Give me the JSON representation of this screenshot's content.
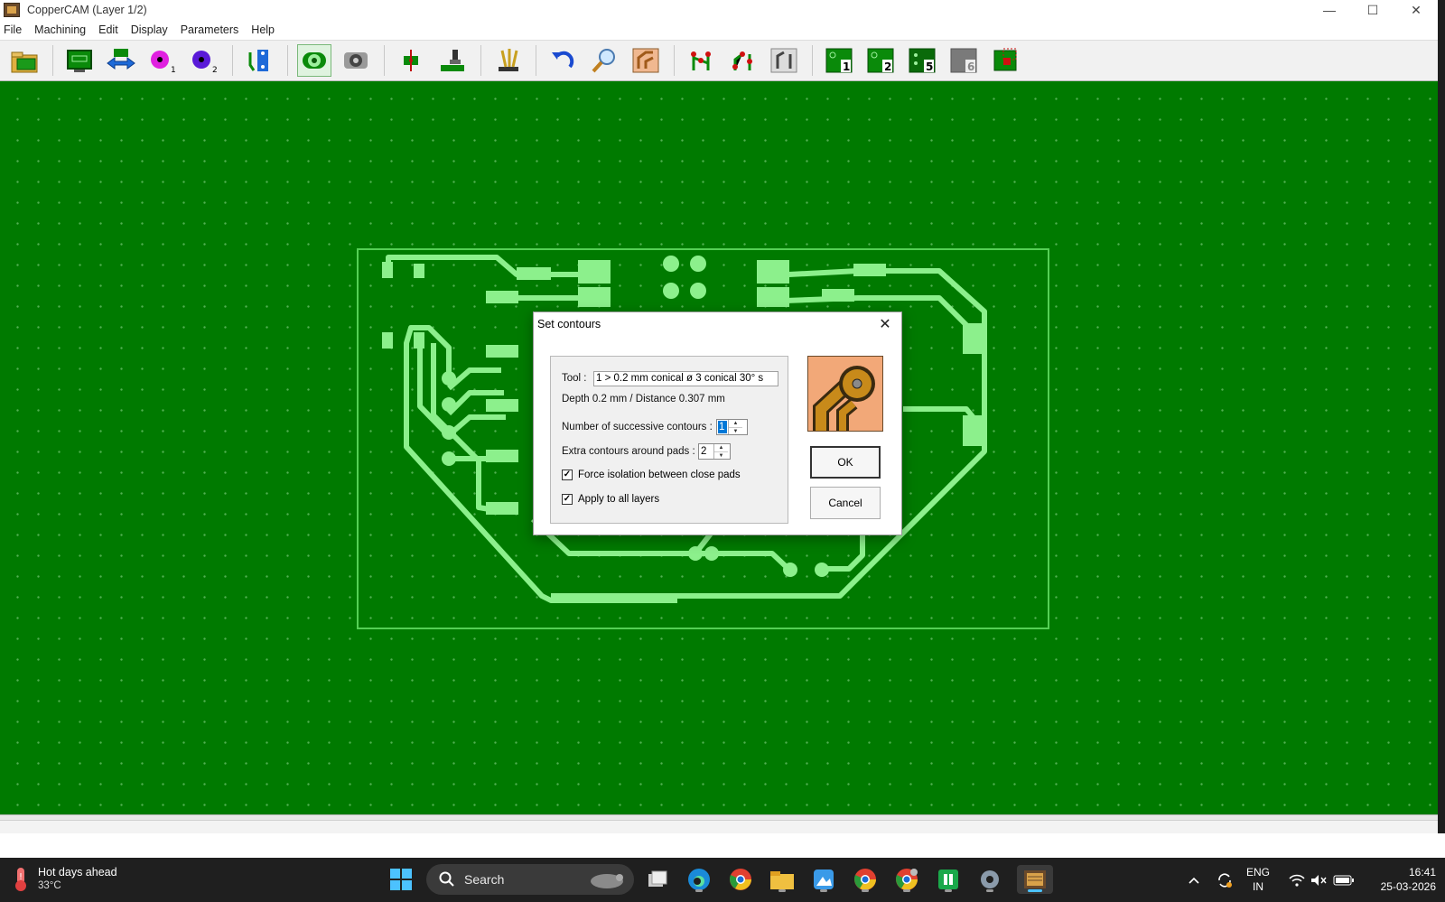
{
  "window": {
    "title": "CopperCAM   (Layer 1/2)",
    "minimize": "—",
    "maximize": "☐",
    "close": "✕"
  },
  "menu": [
    "File",
    "Machining",
    "Edit",
    "Display",
    "Parameters",
    "Help"
  ],
  "toolbar": {
    "via1_sub": "1",
    "via2_sub": "2",
    "layer1": "1",
    "layer2": "2",
    "layer5": "5",
    "layer6": "6"
  },
  "dialog": {
    "title": "Set contours",
    "close": "✕",
    "tool_label": "Tool :",
    "tool_value": "1 > 0.2  mm conical    ø 3   conical 30°   s",
    "depth_text": "Depth 0.2 mm  /  Distance 0.307 mm",
    "contours_label": "Number of successive contours :",
    "contours_value": "1",
    "extra_label": "Extra contours around pads :",
    "extra_value": "2",
    "force_label": "Force isolation between close pads",
    "force_checked": true,
    "apply_label": "Apply to all layers",
    "apply_checked": true,
    "ok": "OK",
    "cancel": "Cancel"
  },
  "taskbar": {
    "weather_title": "Hot days ahead",
    "weather_temp": "33°C",
    "search": "Search",
    "lang1": "ENG",
    "lang2": "IN",
    "time": "16:41",
    "date": "25-03-2026"
  },
  "colors": {
    "canvas": "#007a00",
    "copper": "#8cf08c",
    "outline": "#4fc64f"
  }
}
